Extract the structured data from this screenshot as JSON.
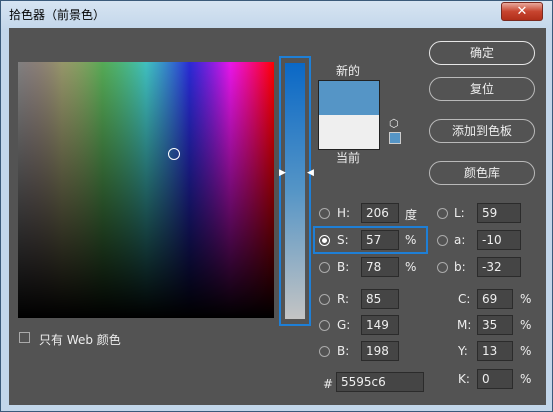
{
  "window": {
    "title": "拾色器（前景色）",
    "close": "✕"
  },
  "swatch": {
    "new_label": "新的",
    "current_label": "当前",
    "new_color": "#5595c6",
    "current_color": "#efefef"
  },
  "buttons": {
    "ok": "确定",
    "reset": "复位",
    "add_swatch": "添加到色板",
    "library": "颜色库"
  },
  "hsb": {
    "h_label": "H:",
    "h": "206",
    "h_unit": "度",
    "s_label": "S:",
    "s": "57",
    "s_unit": "%",
    "b_label": "B:",
    "b": "78",
    "b_unit": "%"
  },
  "lab": {
    "l_label": "L:",
    "l": "59",
    "a_label": "a:",
    "a": "-10",
    "b_label": "b:",
    "b": "-32"
  },
  "rgb": {
    "r_label": "R:",
    "r": "85",
    "g_label": "G:",
    "g": "149",
    "b_label": "B:",
    "b": "198"
  },
  "cmyk": {
    "c_label": "C:",
    "c": "69",
    "m_label": "M:",
    "m": "35",
    "y_label": "Y:",
    "y": "13",
    "k_label": "K:",
    "k": "0",
    "unit": "%"
  },
  "hex": {
    "label": "#",
    "value": "5595c6"
  },
  "web_only": {
    "label": "只有 Web 颜色",
    "checked": false
  },
  "accent": "#1e7fd6"
}
